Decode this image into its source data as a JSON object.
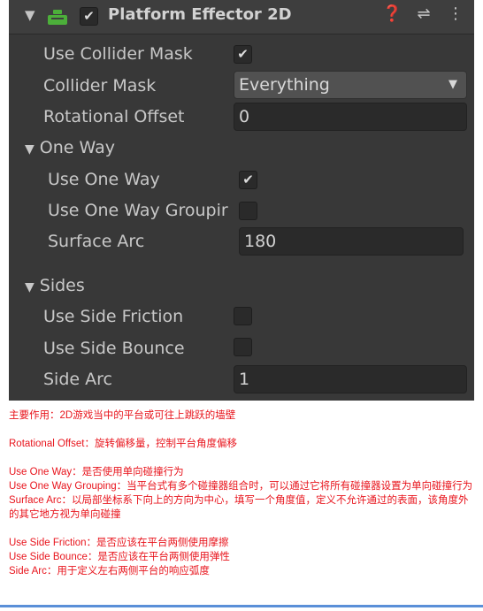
{
  "component": {
    "title": "Platform Effector 2D",
    "enabled": true,
    "icons": [
      "help-icon",
      "preset-icon",
      "kebab-menu-icon"
    ]
  },
  "fields": {
    "use_collider_mask": {
      "label": "Use Collider Mask",
      "checked": true
    },
    "collider_mask": {
      "label": "Collider Mask",
      "value": "Everything"
    },
    "rotational_offset": {
      "label": "Rotational Offset",
      "value": "0"
    }
  },
  "one_way": {
    "header": "One Way",
    "use_one_way": {
      "label": "Use One Way",
      "checked": true
    },
    "use_one_way_grouping": {
      "label": "Use One Way Groupir",
      "checked": false
    },
    "surface_arc": {
      "label": "Surface Arc",
      "value": "180"
    }
  },
  "sides": {
    "header": "Sides",
    "use_side_friction": {
      "label": "Use Side Friction",
      "checked": false
    },
    "use_side_bounce": {
      "label": "Use Side Bounce",
      "checked": false
    },
    "side_arc": {
      "label": "Side Arc",
      "value": "1"
    }
  },
  "notes": {
    "main_purpose": "主要作用：2D游戏当中的平台或可往上跳跃的墙壁",
    "rotational_offset": "Rotational Offset：旋转偏移量，控制平台角度偏移",
    "use_one_way": "Use One Way：是否使用单向碰撞行为",
    "use_one_way_grouping": "Use One Way Grouping：当平台式有多个碰撞器组合时，可以通过它将所有碰撞器设置为单向碰撞行为",
    "surface_arc": "Surface Arc：以局部坐标系下向上的方向为中心，填写一个角度值，定义不允许通过的表面，该角度外的其它地方视为单向碰撞",
    "use_side_friction": "Use Side Friction：是否应该在平台两侧使用摩擦",
    "use_side_bounce": "Use Side Bounce：是否应该在平台两侧使用弹性",
    "side_arc": "Side Arc：用于定义左右两侧平台的响应弧度"
  },
  "colors": {
    "panel_bg": "#383838",
    "field_bg": "#2a2a2a",
    "note_text": "#e8141c",
    "icon_green": "#4caf3a"
  }
}
